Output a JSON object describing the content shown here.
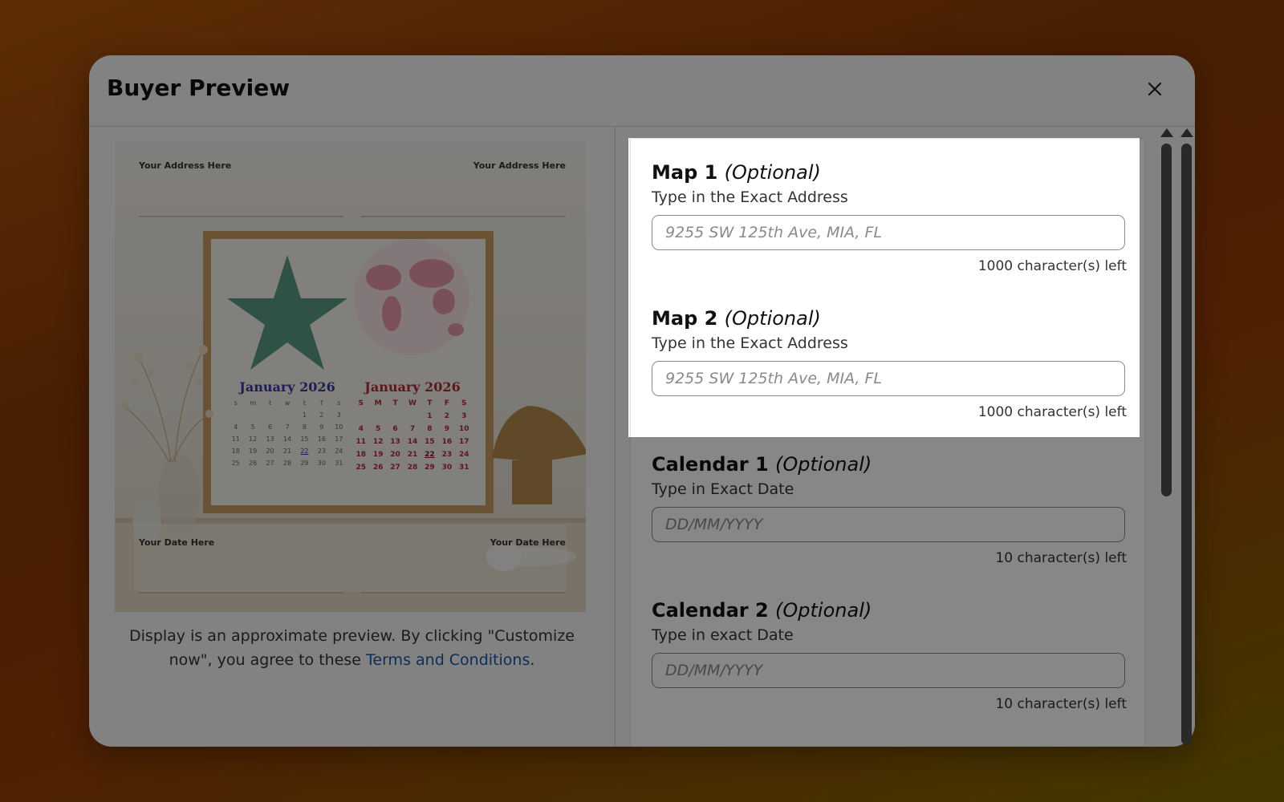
{
  "modal": {
    "title": "Buyer Preview",
    "close_icon": "close-icon"
  },
  "preview": {
    "address_left": "Your Address Here",
    "address_right": "Your Address Here",
    "date_left": "Your Date Here",
    "date_right": "Your Date Here",
    "calendar_left_title": "January 2026",
    "calendar_right_title": "January 2026",
    "calendar_right_days": [
      "S",
      "M",
      "T",
      "W",
      "T",
      "F",
      "S"
    ],
    "calendar_left_days": [
      "s",
      "m",
      "t",
      "w",
      "t",
      "f",
      "s"
    ],
    "calendar_right_rows": [
      [
        "",
        "",
        "",
        "",
        "1",
        "2",
        "3"
      ],
      [
        "4",
        "5",
        "6",
        "7",
        "8",
        "9",
        "10"
      ],
      [
        "11",
        "12",
        "13",
        "14",
        "15",
        "16",
        "17"
      ],
      [
        "18",
        "19",
        "20",
        "21",
        "22",
        "23",
        "24"
      ],
      [
        "25",
        "26",
        "27",
        "28",
        "29",
        "30",
        "31"
      ]
    ],
    "highlight_day": "22",
    "disclaimer_text": "Display is an approximate preview. By clicking \"Customize now\", you agree to these ",
    "terms_link": "Terms and Conditions",
    "disclaimer_end": "."
  },
  "form": {
    "map1": {
      "title": "Map 1",
      "optional": "(Optional)",
      "subtitle": "Type in the Exact Address",
      "placeholder": "9255 SW 125th Ave, MIA, FL",
      "counter": "1000 character(s) left"
    },
    "map2": {
      "title": "Map 2",
      "optional": "(Optional)",
      "subtitle": "Type in the Exact Address",
      "placeholder": "9255 SW 125th Ave, MIA, FL",
      "counter": "1000 character(s) left"
    },
    "calendar1": {
      "title": "Calendar 1",
      "optional": "(Optional)",
      "subtitle": "Type in Exact Date",
      "placeholder": "DD/MM/YYYY",
      "counter": "10 character(s) left"
    },
    "calendar2": {
      "title": "Calendar 2",
      "optional": "(Optional)",
      "subtitle": "Type in exact Date",
      "placeholder": "DD/MM/YYYY",
      "counter": "10 character(s) left"
    }
  },
  "colors": {
    "link": "#1a56a8",
    "calendar_left": "#3b3ba0",
    "calendar_right": "#b02a36",
    "star": "#5b9a84"
  }
}
